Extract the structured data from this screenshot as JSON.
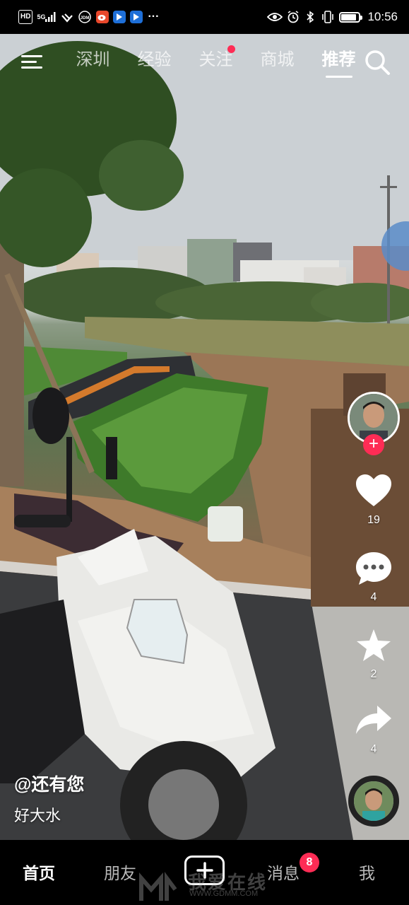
{
  "status_bar": {
    "left_icons": [
      "hd-icon",
      "signal-5g-icon",
      "wifi-icon",
      "speed-icon",
      "weibo-icon",
      "app-icon",
      "app-icon"
    ],
    "hd_label": "HD",
    "network_label": "5G",
    "more": "···",
    "time": "10:56",
    "right_icons": [
      "eye-icon",
      "alarm-icon",
      "bluetooth-icon",
      "vibrate-icon",
      "battery-icon"
    ]
  },
  "top_nav": {
    "tabs": [
      {
        "label": "深圳",
        "active": false
      },
      {
        "label": "经验",
        "active": false
      },
      {
        "label": "关注",
        "active": false,
        "has_dot": true
      },
      {
        "label": "商城",
        "active": false
      },
      {
        "label": "推荐",
        "active": true
      }
    ]
  },
  "right_rail": {
    "like_count": "19",
    "comment_count": "4",
    "favorite_count": "2",
    "share_count": "4"
  },
  "caption": {
    "author": "@还有您",
    "description": "好大水"
  },
  "bottom_nav": {
    "items": [
      "首页",
      "朋友",
      "消息",
      "我"
    ],
    "active": "首页",
    "message_badge": "8"
  },
  "watermark": {
    "text": "我爱在线",
    "url": "WWW.GDMM.COM"
  },
  "colors": {
    "accent": "#fe2c55",
    "background": "#000000"
  }
}
